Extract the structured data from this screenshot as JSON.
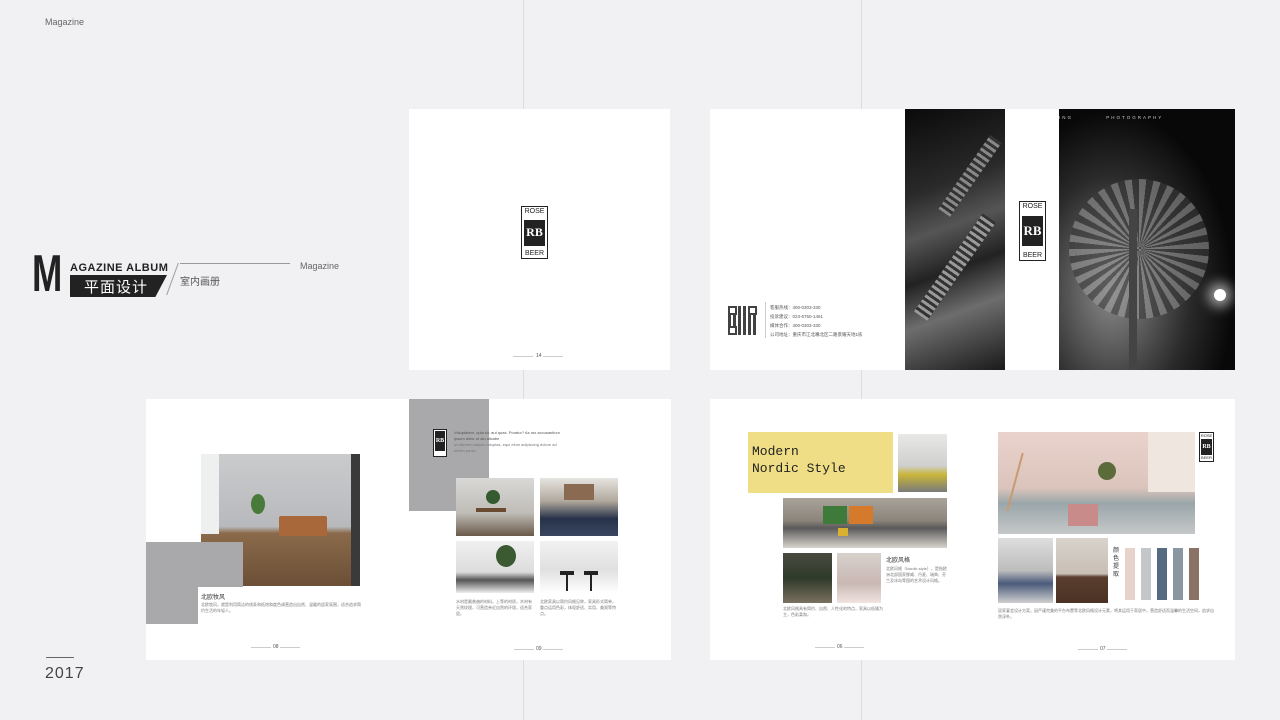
{
  "corner": {
    "label": "Magazine"
  },
  "footer": {
    "year": "2017"
  },
  "title": {
    "letter": "M",
    "album": "AGAZINE ALBUM",
    "cn_main": "平面设计",
    "cn_sub": "室内画册",
    "tag": "Magazine"
  },
  "logo": {
    "top": "ROSE",
    "mark": "RB",
    "bottom": "BEER"
  },
  "spread1": {
    "page_no": "14"
  },
  "spread2": {
    "contact": [
      "客服热线：400-0303-330",
      "投诉建议：023-6750-1461",
      "媒体合作：400-0303-330",
      "公司地址：重庆市江北嘴北区二路景耀天地1栋"
    ],
    "photo_header": [
      "ING",
      "PHOTOGRAPHY"
    ]
  },
  "spread3": {
    "caption": "北欧牧风",
    "left_page_no": "08",
    "right_page_no": "09",
    "intro_text": "Voluptatem, quia sit, aut quas. Poratur? As mo accusantium ipsum dolor ut aiu alicabe"
  },
  "spread4": {
    "heading": [
      "Modern",
      "Nordic Style"
    ],
    "caption": "北欧风格",
    "palette_label": "颜色提取",
    "palette": [
      "#e8d2cc",
      "#c3c7ca",
      "#546b82",
      "#8a97a1",
      "#8a7265"
    ],
    "left_page_no": "06",
    "right_page_no": "07"
  }
}
